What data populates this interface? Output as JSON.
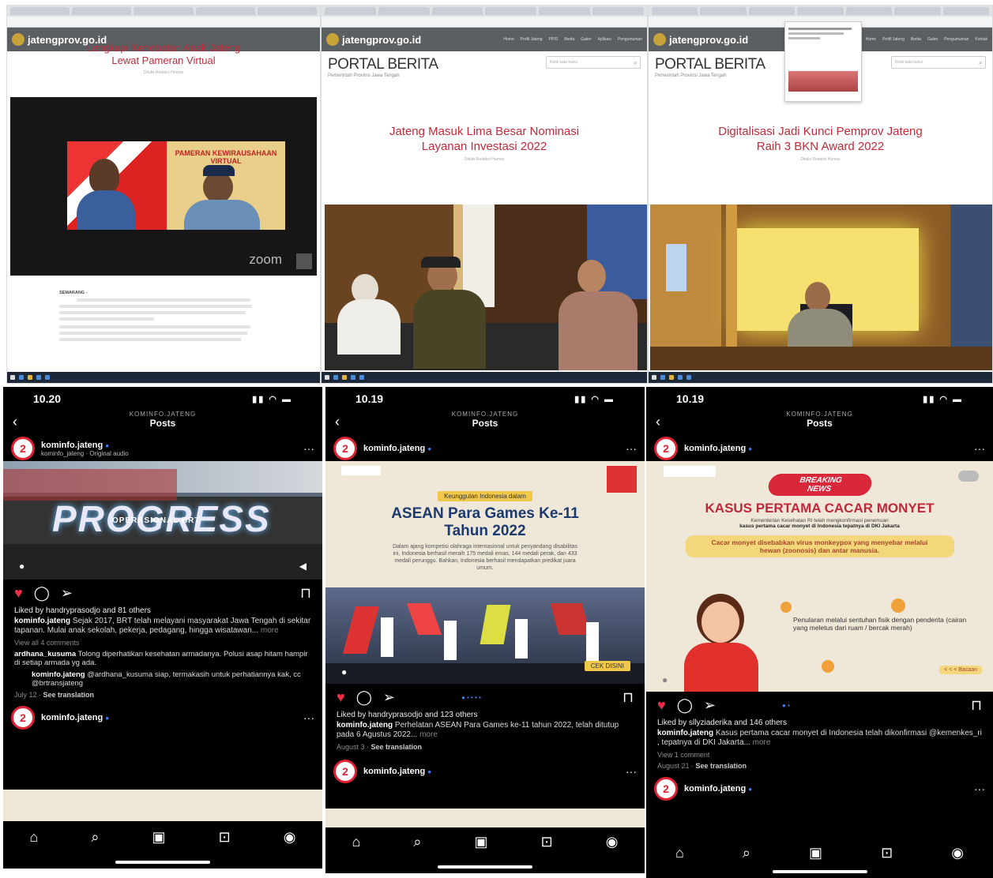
{
  "browser1": {
    "site_logo": "jatengprov.go.id",
    "headline_line1": "Lengkapi Kehebatan Anak Jateng",
    "headline_line2": "Lewat Pameran Virtual",
    "dateline": "Ditulis Redaksi Humas",
    "zoom_label": "zoom",
    "banner_text": "PAMERAN KEWIRAUSAHAAN VIRTUAL",
    "body_lead": "SEMARANG -"
  },
  "browser2": {
    "site_logo": "jatengprov.go.id",
    "portal_title": "PORTAL BERITA",
    "portal_sub": "Pemerintah Provinsi Jawa Tengah",
    "search_placeholder": "Ketik kata kunci",
    "headline_line1": "Jateng Masuk Lima Besar Nominasi",
    "headline_line2": "Layanan Investasi 2022",
    "dateline": "Ditulis Redaksi Humas"
  },
  "browser3": {
    "site_logo": "jatengprov.go.id",
    "portal_title": "PORTAL BERITA",
    "portal_sub": "Pemerintah Provinsi Jawa Tengah",
    "search_placeholder": "Ketik kata kunci",
    "headline_line1": "Digitalisasi Jadi Kunci Pemprov Jateng",
    "headline_line2": "Raih 3 BKN Award 2022",
    "dateline": "Ditulis Redaksi Humas"
  },
  "nav_items": [
    "Home",
    "Profil Jateng",
    "PPID",
    "Berita",
    "Galeri",
    "Aplikasi",
    "Pengumuman",
    "Kontak"
  ],
  "phone1": {
    "time": "10.20",
    "account_header": "KOMINFO.JATENG",
    "posts_label": "Posts",
    "username": "kominfo.jateng",
    "audio": "kominfo_jateng · Original audio",
    "reel_title": "PROGRESS",
    "reel_subtitle": "OPERASIONAL BRT",
    "liked_by": "Liked by handryprasodjo and 81 others",
    "caption_user": "kominfo.jateng",
    "caption_text": "Sejak 2017, BRT telah melayani masyarakat Jawa Tengah di sekitar tapanan. Mulai anak sekolah, pekerja, pedagang, hingga wisatawan...",
    "caption_more": "more",
    "view_comments": "View all 4 comments",
    "comment1_user": "ardhana_kusuma",
    "comment1_text": "Tolong diperhatikan kesehatan armadanya. Polusi asap hitam hampir di setiap armada yg ada.",
    "comment2_user": "kominfo.jateng",
    "comment2_text": "@ardhana_kusuma siap, termakasih untuk perhatiannya kak, cc @brtransjateng",
    "date": "July 12",
    "see_translation": "See translation",
    "next_username": "kominfo.jateng"
  },
  "phone2": {
    "time": "10.19",
    "account_header": "KOMINFO.JATENG",
    "posts_label": "Posts",
    "username": "kominfo.jateng",
    "poster_tag": "Keunggulan Indonesia dalam",
    "poster_title_line1": "ASEAN Para Games Ke-11",
    "poster_title_line2": "Tahun 2022",
    "poster_body": "Dalam ajang kompetisi olahraga internasional untuk penyandang disabilitas ini, Indonesia berhasil meraih 175 medali emas, 144 medali perak, dan 433 medali perunggu. Bahkan, Indonesia berhasil mendapatkan predikat juara umum.",
    "poster_cta": "CEK DISINI",
    "liked_by": "Liked by handryprasodjo and 123 others",
    "caption_user": "kominfo.jateng",
    "caption_text": "Perhelatan ASEAN Para Games ke-11 tahun 2022, telah ditutup pada 6 Agustus 2022...",
    "caption_more": "more",
    "date": "August 3",
    "see_translation": "See translation",
    "next_username": "kominfo.jateng"
  },
  "phone3": {
    "time": "10.19",
    "account_header": "KOMINFO.JATENG",
    "posts_label": "Posts",
    "username": "kominfo.jateng",
    "breaking_line1": "BREAKING",
    "breaking_line2": "NEWS",
    "poster_title": "KASUS PERTAMA CACAR MONYET",
    "poster_sub1": "Kementerian Kesehatan RI telah mengkonfirmasi penemuan",
    "poster_sub2": "kasus pertama cacar monyet di Indonesia tepatnya di DKI Jakarta",
    "poster_box": "Cacar monyet disebabkan virus monkeypox yang menyebar melalui hewan (zoonosis) dan antar manusia.",
    "poster_body": "Penularan melalui sentuhan fisik dengan penderita (cairan yang meletus dari ruam / bercak merah)",
    "poster_more": "< < < Bacaan",
    "liked_by": "Liked by sllyziaderika and 146 others",
    "caption_user": "kominfo.jateng",
    "caption_text": "Kasus pertama cacar monyet di Indonesia telah dikonfirmasi @kemenkes_ri , tepatnya di DKI Jakarta...",
    "caption_more": "more",
    "view_comments": "View 1 comment",
    "date": "August 21",
    "see_translation": "See translation",
    "next_username": "kominfo.jateng"
  },
  "colors": {
    "headline_red": "#c22a3a",
    "instagram_black": "#000000",
    "heart_red": "#ef2f4a",
    "site_bar_grey": "#5c5f62"
  },
  "icons": [
    "back-icon",
    "more-icon",
    "heart-icon",
    "comment-icon",
    "share-icon",
    "save-icon",
    "home-icon",
    "search-icon",
    "reels-icon",
    "shop-icon",
    "profile-icon",
    "verified-icon"
  ]
}
